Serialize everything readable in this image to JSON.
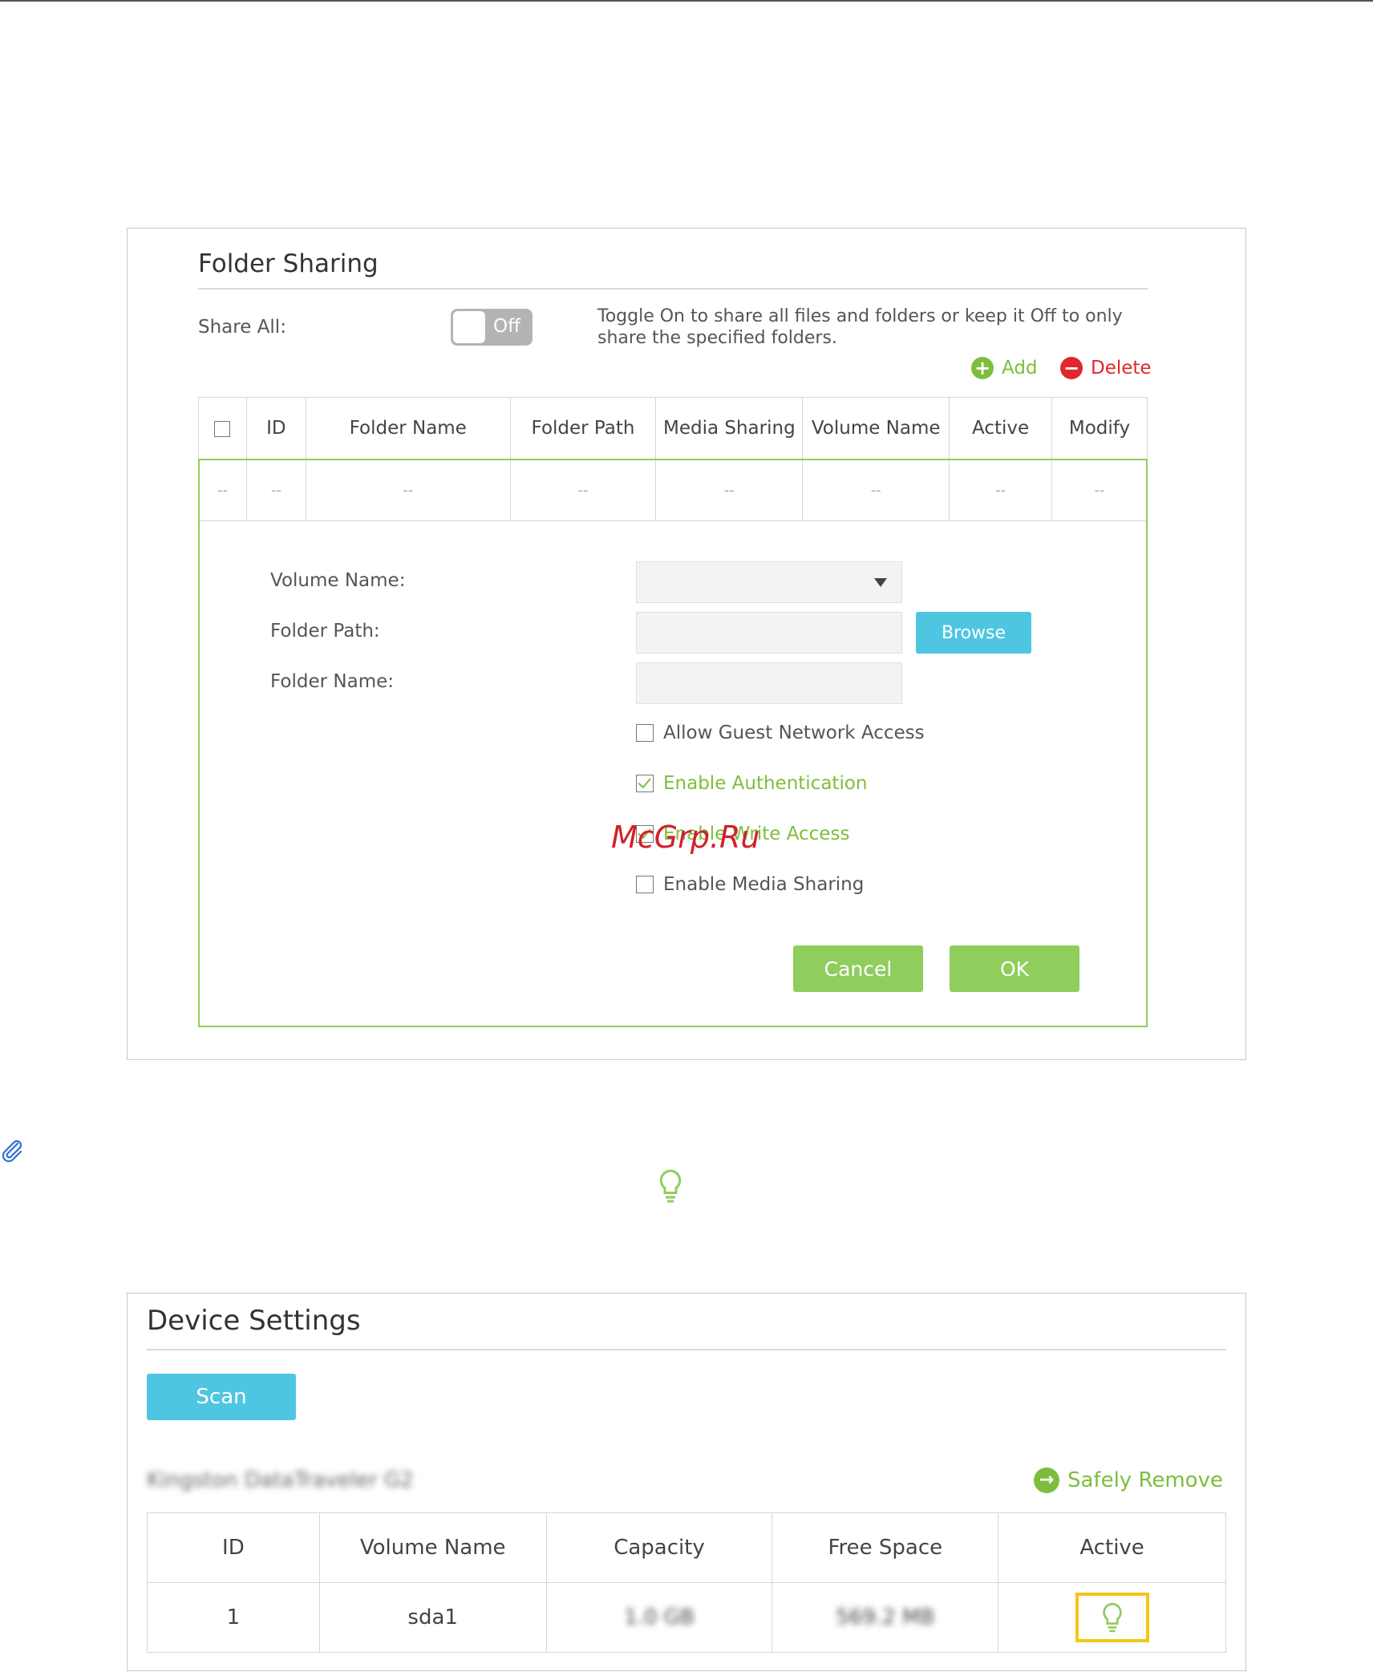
{
  "watermark": "McGrp.Ru",
  "folder_sharing": {
    "title": "Folder Sharing",
    "share_all_label": "Share All:",
    "toggle_state": "Off",
    "hint": "Toggle On to share all files and folders or keep it Off to only share the specified folders.",
    "add_label": "Add",
    "delete_label": "Delete",
    "columns": [
      "ID",
      "Folder Name",
      "Folder Path",
      "Media Sharing",
      "Volume Name",
      "Active",
      "Modify"
    ],
    "empty_cell": "--",
    "form": {
      "volume_name_label": "Volume Name:",
      "volume_name_value": "",
      "folder_path_label": "Folder Path:",
      "folder_path_value": "",
      "browse_label": "Browse",
      "folder_name_label": "Folder Name:",
      "folder_name_value": "",
      "options": [
        {
          "label": "Allow Guest Network Access",
          "checked": false
        },
        {
          "label": "Enable Authentication",
          "checked": true
        },
        {
          "label": "Enable Write Access",
          "checked": true
        },
        {
          "label": "Enable Media Sharing",
          "checked": false
        }
      ],
      "cancel_label": "Cancel",
      "ok_label": "OK"
    }
  },
  "device_settings": {
    "title": "Device Settings",
    "scan_label": "Scan",
    "device_name": "Kingston DataTraveler G2",
    "safely_remove_label": "Safely Remove",
    "columns": [
      "ID",
      "Volume Name",
      "Capacity",
      "Free Space",
      "Active"
    ],
    "rows": [
      {
        "id": "1",
        "volume": "sda1",
        "capacity": "1.0 GB",
        "free": "569.2 MB"
      }
    ]
  },
  "colors": {
    "green": "#8fcd5d",
    "blue": "#4fc6e1",
    "red": "#e0272f",
    "highlight": "#f5c518"
  }
}
